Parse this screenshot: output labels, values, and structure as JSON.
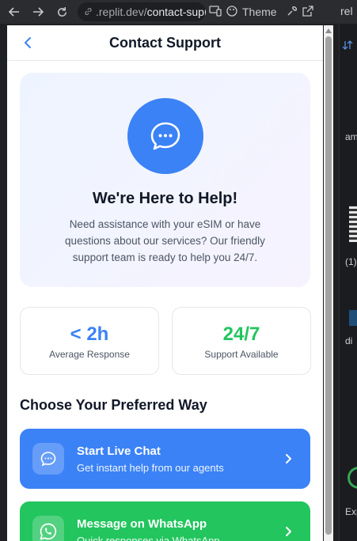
{
  "browser": {
    "url_domain": ".replit.dev/",
    "url_path": "contact-suppor",
    "theme_label": "Theme",
    "side_tab_text": "rel"
  },
  "side_panel": {
    "texts": [
      "am",
      "(1)",
      "di",
      "Exp"
    ]
  },
  "header": {
    "title": "Contact Support"
  },
  "hero": {
    "title": "We're Here to Help!",
    "description": "Need assistance with your eSIM or have questions about our services? Our friendly support team is ready to help you 24/7.",
    "icon": "chat-bubble-icon"
  },
  "stats": [
    {
      "value": "< 2h",
      "label": "Average Response",
      "color": "#3b82f6"
    },
    {
      "value": "24/7",
      "label": "Support Available",
      "color": "#22c55e"
    }
  ],
  "section": {
    "title": "Choose Your Preferred Way"
  },
  "options": [
    {
      "title": "Start Live Chat",
      "subtitle": "Get instant help from our agents",
      "color": "#3b82f6",
      "icon": "chat-icon"
    },
    {
      "title": "Message on WhatsApp",
      "subtitle": "Quick responses via WhatsApp",
      "color": "#22c55e",
      "icon": "whatsapp-icon"
    }
  ],
  "colors": {
    "primary": "#3b82f6",
    "success": "#22c55e"
  }
}
